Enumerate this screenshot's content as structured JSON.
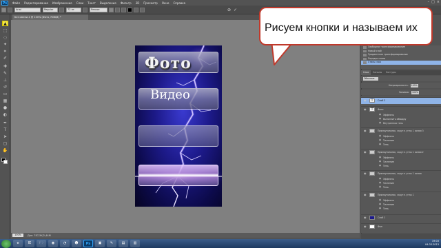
{
  "app": {
    "logo": "Ps"
  },
  "menu": [
    "Файл",
    "Редактирование",
    "Изображение",
    "Слои",
    "Текст",
    "Выделение",
    "Фильтр",
    "3D",
    "Просмотр",
    "Окно",
    "Справка"
  ],
  "options": {
    "font_family": "Arial",
    "font_style": "Regular",
    "font_size": "72 пт",
    "antialias": "Резкое"
  },
  "document": {
    "tab_title": "Без имени-1 @ 100% (Фото, RGB/8) *"
  },
  "canvas": {
    "buttons": [
      {
        "label": "Фото"
      },
      {
        "label": "Видео"
      },
      {
        "label": ""
      },
      {
        "label": ""
      }
    ]
  },
  "status": {
    "zoom": "100%",
    "doc_info": "Док: 787,5K/2,44M"
  },
  "callout": {
    "text": "Рисуем кнопки и называем их"
  },
  "history": {
    "items": [
      {
        "label": "Свободное трансформирование",
        "active": false
      },
      {
        "label": "Новый слой",
        "active": false
      },
      {
        "label": "Градиентное трансформирование",
        "active": false
      },
      {
        "label": "Порядок слоев",
        "active": false
      },
      {
        "label": "Стиль слоя",
        "active": true
      }
    ]
  },
  "panel_tabs": [
    "Слои",
    "Каналы",
    "Контуры"
  ],
  "layers_panel": {
    "kind": "Обычные",
    "opacity_label": "Непрозрачность:",
    "opacity_value": "100%",
    "fill_label": "Заливка:",
    "fill_value": "100%",
    "layers": [
      {
        "type": "main",
        "thumb": "text",
        "name": "Слой 2",
        "selected": true
      },
      {
        "type": "main",
        "thumb": "text",
        "name": "Фото",
        "selected": false
      },
      {
        "type": "sub",
        "name": "Эффекты"
      },
      {
        "type": "sub",
        "name": "Выполнить обводку"
      },
      {
        "type": "sub",
        "name": "Внутренняя тень"
      },
      {
        "type": "main",
        "thumb": "shape",
        "name": "Прямоугольник, скругл. углы 1 копия 3",
        "selected": false
      },
      {
        "type": "sub",
        "name": "Эффекты"
      },
      {
        "type": "sub",
        "name": "Тиснение"
      },
      {
        "type": "sub",
        "name": "Тень"
      },
      {
        "type": "main",
        "thumb": "shape",
        "name": "Прямоугольник, скругл. углы 1 копия 2",
        "selected": false
      },
      {
        "type": "sub",
        "name": "Эффекты"
      },
      {
        "type": "sub",
        "name": "Тиснение"
      },
      {
        "type": "sub",
        "name": "Тень"
      },
      {
        "type": "main",
        "thumb": "shape",
        "name": "Прямоугольник, скругл. углы 1 копия",
        "selected": false
      },
      {
        "type": "sub",
        "name": "Эффекты"
      },
      {
        "type": "sub",
        "name": "Тиснение"
      },
      {
        "type": "sub",
        "name": "Тень"
      },
      {
        "type": "main",
        "thumb": "shape",
        "name": "Прямоугольник, скругл. углы 1",
        "selected": false
      },
      {
        "type": "sub",
        "name": "Эффекты"
      },
      {
        "type": "sub",
        "name": "Тиснение"
      },
      {
        "type": "sub",
        "name": "Тень"
      },
      {
        "type": "main",
        "thumb": "image",
        "name": "Слой 1",
        "selected": false
      },
      {
        "type": "main",
        "thumb": "bg",
        "name": "Фон",
        "selected": false
      }
    ]
  },
  "taskbar": {
    "apps": [
      "e",
      "IE",
      "🗁",
      "◉",
      "◔",
      "☻",
      "Ps",
      "▣",
      "✎",
      "▤",
      "▥"
    ],
    "time": "19:03",
    "date": "04.03.2013"
  },
  "colors": {
    "accent": "#f3e84a",
    "callout_border": "#c0392b",
    "selection": "#8fb4e8"
  }
}
